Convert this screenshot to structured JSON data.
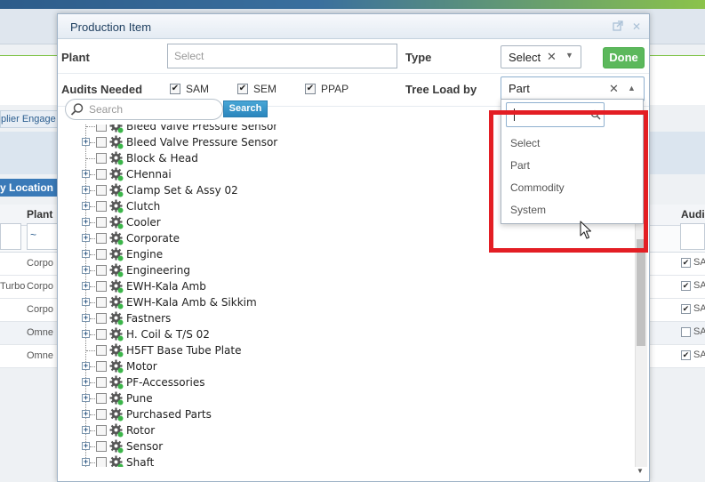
{
  "background": {
    "supplier_tab": "plier Engage",
    "location_tab": "y Location",
    "plant_header": "Plant",
    "audit_header": "Audi",
    "filter_symbol": "~",
    "rows": [
      {
        "left": "",
        "plant": "Corpo",
        "audit_checked": true,
        "audit_label": "SA"
      },
      {
        "left": "Turbo",
        "plant": "Corpo",
        "audit_checked": true,
        "audit_label": "SA"
      },
      {
        "left": "",
        "plant": "Corpo",
        "audit_checked": true,
        "audit_label": "SA"
      },
      {
        "left": "",
        "plant": "Omne",
        "audit_checked": false,
        "audit_label": "SA"
      },
      {
        "left": "",
        "plant": "Omne",
        "audit_checked": true,
        "audit_label": "SA"
      }
    ]
  },
  "modal": {
    "title": "Production Item",
    "plant": {
      "label": "Plant",
      "placeholder": "Select"
    },
    "type": {
      "label": "Type",
      "value": "Select"
    },
    "done_label": "Done",
    "audits": {
      "label": "Audits Needed",
      "items": [
        {
          "label": "SAM",
          "checked": true
        },
        {
          "label": "SEM",
          "checked": true
        },
        {
          "label": "PPAP",
          "checked": true
        }
      ]
    },
    "tree_load": {
      "label": "Tree Load by",
      "value": "Part"
    },
    "search": {
      "placeholder": "Search",
      "button": "Search"
    },
    "tree": [
      {
        "label": "Bleed Valve Pressure Sensor",
        "expandable": false
      },
      {
        "label": "Bleed Valve Pressure Sensor",
        "expandable": true
      },
      {
        "label": "Block & Head",
        "expandable": false
      },
      {
        "label": "CHennai",
        "expandable": true
      },
      {
        "label": "Clamp Set & Assy 02",
        "expandable": true
      },
      {
        "label": "Clutch",
        "expandable": true
      },
      {
        "label": "Cooler",
        "expandable": true
      },
      {
        "label": "Corporate",
        "expandable": true
      },
      {
        "label": "Engine",
        "expandable": true
      },
      {
        "label": "Engineering",
        "expandable": true
      },
      {
        "label": "EWH-Kala Amb",
        "expandable": true
      },
      {
        "label": "EWH-Kala Amb & Sikkim",
        "expandable": true
      },
      {
        "label": "Fastners",
        "expandable": true
      },
      {
        "label": "H. Coil & T/S 02",
        "expandable": true
      },
      {
        "label": "H5FT Base Tube Plate",
        "expandable": false
      },
      {
        "label": "Motor",
        "expandable": true
      },
      {
        "label": "PF-Accessories",
        "expandable": true
      },
      {
        "label": "Pune",
        "expandable": true
      },
      {
        "label": "Purchased Parts",
        "expandable": true
      },
      {
        "label": "Rotor",
        "expandable": true
      },
      {
        "label": "Sensor",
        "expandable": true
      },
      {
        "label": "Shaft",
        "expandable": true
      }
    ]
  },
  "dropdown": {
    "options": [
      "Select",
      "Part",
      "Commodity",
      "System"
    ]
  },
  "colors": {
    "highlight": "#e31e24",
    "done": "#5cb85c",
    "search_button": "#2b86bd",
    "tab_blue": "#3a7ab8"
  }
}
